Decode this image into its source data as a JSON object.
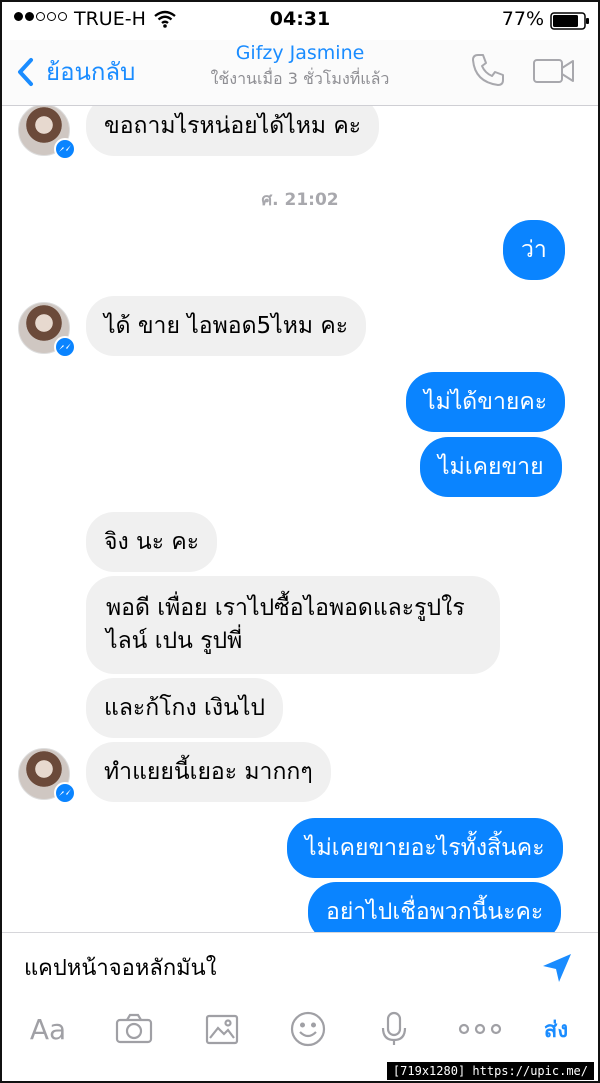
{
  "status_bar": {
    "carrier": "TRUE-H",
    "time": "04:31",
    "battery": "77%"
  },
  "nav": {
    "back_label": "ย้อนกลับ",
    "title": "Gifzy Jasmine",
    "subtitle": "ใช้งานเมื่อ 3 ชั่วโมงที่แล้ว"
  },
  "chat": {
    "timestamp": "ศ. 21:02",
    "messages": [
      {
        "side": "in",
        "text": "ขอถามไรหน่อยได้ไหม คะ"
      },
      {
        "side": "out",
        "text": "ว่า"
      },
      {
        "side": "in",
        "text": "ได้ ขาย ไอพอด5ไหม คะ"
      },
      {
        "side": "out",
        "text": "ไม่ได้ขายคะ"
      },
      {
        "side": "out",
        "text": "ไม่เคยขาย"
      },
      {
        "side": "in",
        "text": "จิง นะ คะ"
      },
      {
        "side": "in",
        "text": "พอดี เพื่อย เราไปซื้อไอพอดและรูปใร ไลน์ เปน รูปพี่"
      },
      {
        "side": "in",
        "text": "และก้โกง เงินไป"
      },
      {
        "side": "in",
        "text": "ทำแยยนี้เยอะ มากกๆ"
      },
      {
        "side": "out",
        "text": "ไม่เคยขายอะไรทั้งสิ้นคะ"
      },
      {
        "side": "out",
        "text": "อย่าไปเชื่อพวกนี้นะคะ"
      }
    ]
  },
  "composer": {
    "value": "แคปหน้าจอหลักมันใ"
  },
  "toolbar": {
    "text_label": "Aa",
    "send_label": "ส่ง"
  },
  "watermark": "[719x1280] https://upic.me/",
  "colors": {
    "accent": "#1a8cff",
    "outgoing_bubble": "#0a84ff",
    "incoming_bubble": "#f0f0f0"
  }
}
